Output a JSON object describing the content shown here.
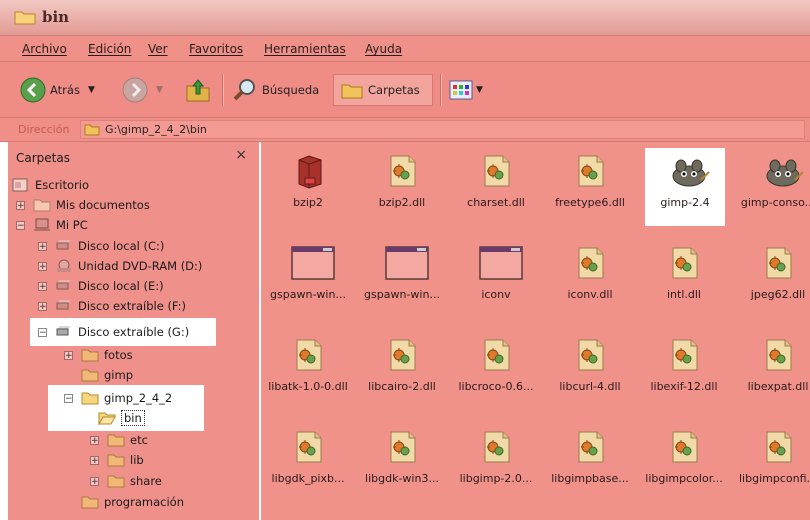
{
  "window": {
    "title": "bin"
  },
  "menu": [
    "Archivo",
    "Edición",
    "Ver",
    "Favoritos",
    "Herramientas",
    "Ayuda"
  ],
  "toolbar": {
    "back_label": "Atrás",
    "search_label": "Búsqueda",
    "folders_label": "Carpetas"
  },
  "address": {
    "label": "Dirección",
    "path": "G:\\gimp_2_4_2\\bin"
  },
  "folders_pane": {
    "title": "Carpetas",
    "close": "×",
    "items": [
      {
        "label": "Escritorio"
      },
      {
        "label": "Mis documentos"
      },
      {
        "label": "Mi PC"
      },
      {
        "label": "Disco local (C:)"
      },
      {
        "label": "Unidad DVD-RAM (D:)"
      },
      {
        "label": "Disco local (E:)"
      },
      {
        "label": "Disco extraíble (F:)"
      },
      {
        "label": "Disco extraíble (G:)"
      },
      {
        "label": "fotos"
      },
      {
        "label": "gimp"
      },
      {
        "label": "gimp_2_4_2"
      },
      {
        "label": "bin"
      },
      {
        "label": "etc"
      },
      {
        "label": "lib"
      },
      {
        "label": "share"
      },
      {
        "label": "programación"
      }
    ]
  },
  "files": [
    {
      "name": "bzip2",
      "icon": "archive-icon"
    },
    {
      "name": "bzip2.dll",
      "icon": "dll-icon"
    },
    {
      "name": "charset.dll",
      "icon": "dll-icon"
    },
    {
      "name": "freetype6.dll",
      "icon": "dll-icon"
    },
    {
      "name": "gimp-2.4",
      "icon": "gimp-icon"
    },
    {
      "name": "gimp-conso...",
      "icon": "gimp-icon"
    },
    {
      "name": "gspawn-win...",
      "icon": "exe-window-icon"
    },
    {
      "name": "gspawn-win...",
      "icon": "exe-window-icon"
    },
    {
      "name": "iconv",
      "icon": "exe-window-icon"
    },
    {
      "name": "iconv.dll",
      "icon": "dll-icon"
    },
    {
      "name": "intl.dll",
      "icon": "dll-icon"
    },
    {
      "name": "jpeg62.dll",
      "icon": "dll-icon"
    },
    {
      "name": "libatk-1.0-0.dll",
      "icon": "dll-icon"
    },
    {
      "name": "libcairo-2.dll",
      "icon": "dll-icon"
    },
    {
      "name": "libcroco-0.6...",
      "icon": "dll-icon"
    },
    {
      "name": "libcurl-4.dll",
      "icon": "dll-icon"
    },
    {
      "name": "libexif-12.dll",
      "icon": "dll-icon"
    },
    {
      "name": "libexpat.dll",
      "icon": "dll-icon"
    },
    {
      "name": "libgdk_pixb...",
      "icon": "dll-icon"
    },
    {
      "name": "libgdk-win3...",
      "icon": "dll-icon"
    },
    {
      "name": "libgimp-2.0...",
      "icon": "dll-icon"
    },
    {
      "name": "libgimpbase...",
      "icon": "dll-icon"
    },
    {
      "name": "libgimpcolor...",
      "icon": "dll-icon"
    },
    {
      "name": "libgimpconfi...",
      "icon": "dll-icon"
    }
  ],
  "colors": {
    "tint": "#ef8f88",
    "title": "#e39a93",
    "highlight": "#ffffff"
  }
}
